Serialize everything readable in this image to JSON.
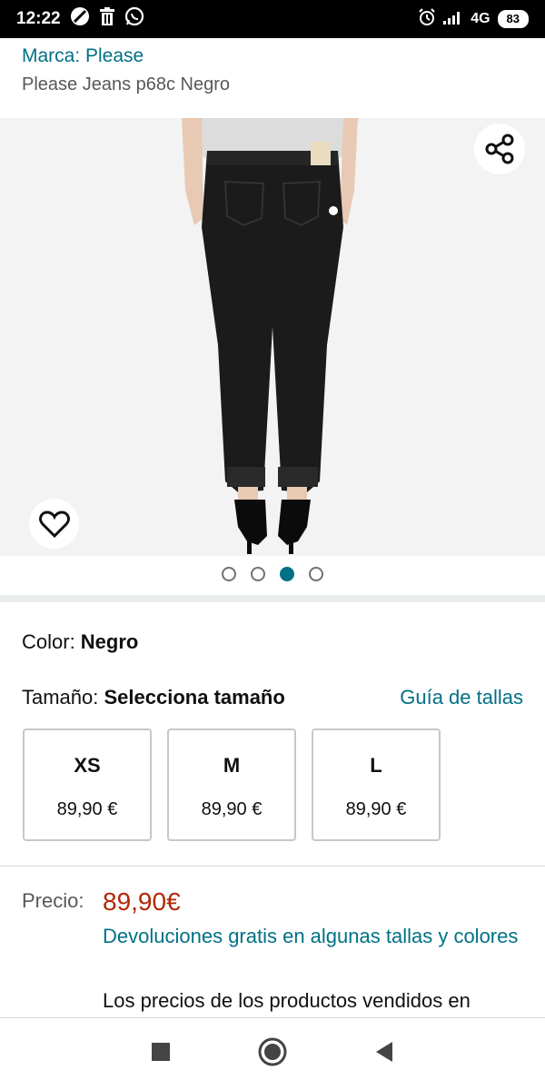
{
  "status_bar": {
    "time": "12:22",
    "network": "4G",
    "battery": "83",
    "icons": [
      "do-not-disturb-icon",
      "delete-icon",
      "whatsapp-icon",
      "alarm-icon",
      "signal-icon",
      "battery-icon"
    ]
  },
  "product": {
    "brand": "Marca: Please",
    "title": "Please Jeans p68c Negro"
  },
  "gallery": {
    "image_count": 4,
    "active_index": 3,
    "share_icon": "share-icon",
    "favorite_icon": "heart-icon"
  },
  "color": {
    "label": "Color: ",
    "value": "Negro"
  },
  "size": {
    "label": "Tamaño: ",
    "value": "Selecciona tamaño",
    "guide_link": "Guía de tallas",
    "options": [
      {
        "name": "XS",
        "price": "89,90 €"
      },
      {
        "name": "M",
        "price": "89,90 €"
      },
      {
        "name": "L",
        "price": "89,90 €"
      }
    ]
  },
  "pricing": {
    "label": "Precio:",
    "value": "89,90€",
    "returns_link": "Devoluciones gratis en algunas tallas y colores",
    "note": "Los precios de los productos vendidos en"
  },
  "colors": {
    "link": "#007185",
    "price": "#b12704",
    "secondary_text": "#565959"
  },
  "nav_bar": {
    "icons": [
      "recents-icon",
      "home-icon",
      "back-icon"
    ]
  }
}
